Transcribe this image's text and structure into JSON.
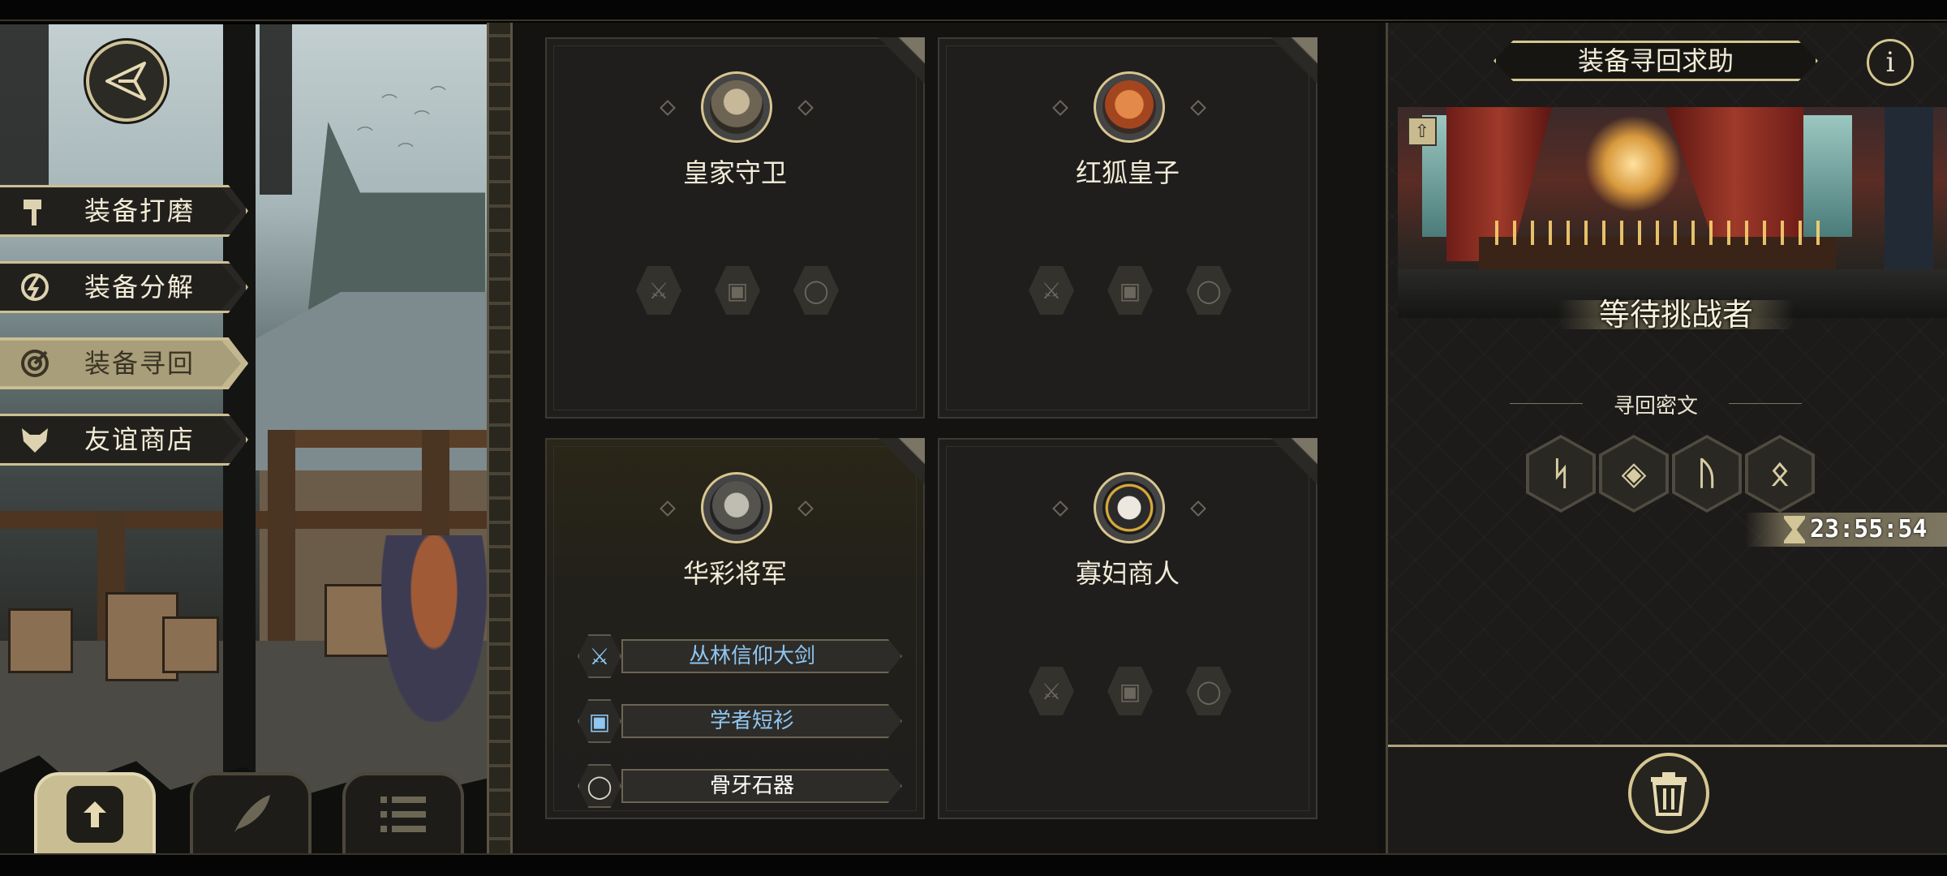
{
  "menu": {
    "items": [
      {
        "label": "装备打磨",
        "icon": "hammer-icon"
      },
      {
        "label": "装备分解",
        "icon": "decompose-icon"
      },
      {
        "label": "装备寻回",
        "icon": "retrieve-icon",
        "active": true
      },
      {
        "label": "友谊商店",
        "icon": "fox-icon"
      }
    ]
  },
  "bottom_tabs": [
    {
      "icon": "upload-icon",
      "active": true
    },
    {
      "icon": "feather-icon",
      "active": false
    },
    {
      "icon": "list-icon",
      "active": false
    }
  ],
  "cards": [
    {
      "name": "皇家守卫",
      "portrait": "royal-guard-portrait",
      "equipment": []
    },
    {
      "name": "红狐皇子",
      "portrait": "red-fox-prince-portrait",
      "equipment": []
    },
    {
      "name": "华彩将军",
      "portrait": "splendid-general-portrait",
      "equipment": [
        {
          "name": "丛林信仰大剑",
          "icon": "sword-icon",
          "color": "#8fc6f2"
        },
        {
          "name": "学者短衫",
          "icon": "armor-icon",
          "color": "#8fc6f2"
        },
        {
          "name": "骨牙石器",
          "icon": "ring-icon",
          "color": "#ffffff"
        }
      ]
    },
    {
      "name": "寡妇商人",
      "portrait": "widow-merchant-portrait",
      "equipment": []
    }
  ],
  "right_panel": {
    "title": "装备寻回求助",
    "info_symbol": "i",
    "status": "等待挑战者",
    "runes_label": "寻回密文",
    "runes": [
      "ᛋ",
      "◈",
      "ᚢ",
      "ᛟ"
    ],
    "timer": "23:55:54"
  },
  "colors": {
    "accent_gold": "#d5c690",
    "rare_blue": "#8fc6f2"
  }
}
